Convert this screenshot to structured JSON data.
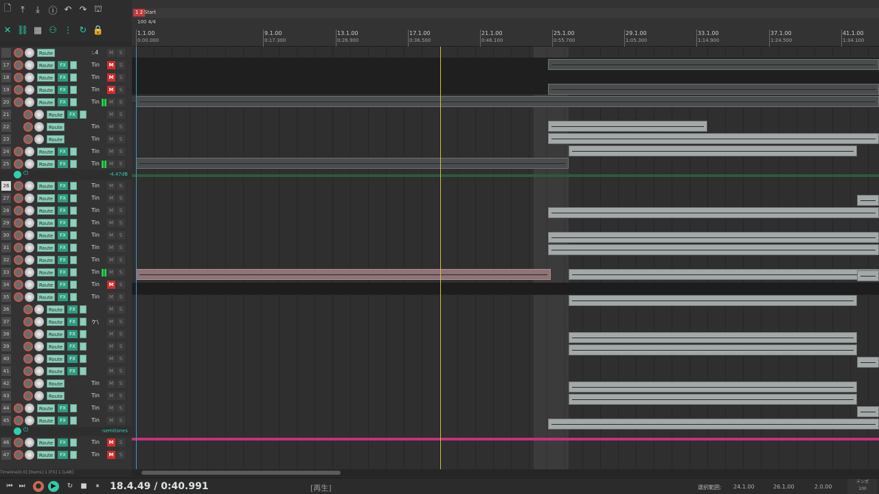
{
  "toolbar": {
    "buttons": [
      "new-file-icon",
      "import-icon",
      "save-icon",
      "info-icon",
      "undo-icon",
      "redo-icon",
      "metronome-icon",
      "ripple-edit-icon",
      "link-icon",
      "grid-icon",
      "snap-icon",
      "snap2-icon",
      "loop-icon",
      "lock-icon"
    ]
  },
  "ruler": {
    "marker_number": "1 2",
    "marker_name": "Start",
    "tempo": "100 4/4",
    "bars": [
      {
        "bar": "1.1.00",
        "time": "0:00.000"
      },
      {
        "bar": "9.1.00",
        "time": "0:17.300"
      },
      {
        "bar": "13.1.00",
        "time": "0:26.900"
      },
      {
        "bar": "17.1.00",
        "time": "0:36.500"
      },
      {
        "bar": "21.1.00",
        "time": "0:46.100"
      },
      {
        "bar": "25.1.00",
        "time": "0:55.700"
      },
      {
        "bar": "29.1.00",
        "time": "1:05.300"
      },
      {
        "bar": "33.1.00",
        "time": "1:14.900"
      },
      {
        "bar": "37.1.00",
        "time": "1:24.500"
      },
      {
        "bar": "41.1.00",
        "time": "1:34.100"
      }
    ]
  },
  "tracks": [
    {
      "num": "",
      "label": ":.4",
      "mute": false
    },
    {
      "num": "17",
      "label": "Tin",
      "mute": true,
      "route_only": false
    },
    {
      "num": "18",
      "label": "Tin",
      "mute": true
    },
    {
      "num": "19",
      "label": "Tin",
      "mute": true
    },
    {
      "num": "20",
      "label": "Tin",
      "mute": false,
      "meter": true
    },
    {
      "num": "21",
      "label": "",
      "mute": false
    },
    {
      "num": "22",
      "label": "Tin",
      "mute": false
    },
    {
      "num": "23",
      "label": "Tin",
      "mute": false
    },
    {
      "num": "24",
      "label": "Tin",
      "mute": false
    },
    {
      "num": "25",
      "label": "Tin",
      "mute": false,
      "meter": true
    }
  ],
  "bus1": {
    "value": "-4.47dB"
  },
  "tracks2": [
    {
      "num": "26",
      "label": "Tin",
      "mute": false
    },
    {
      "num": "27",
      "label": "Tin",
      "mute": false
    },
    {
      "num": "28",
      "label": "Tin",
      "mute": false
    },
    {
      "num": "29",
      "label": "Tin",
      "mute": false
    },
    {
      "num": "30",
      "label": "Tin",
      "mute": false
    },
    {
      "num": "31",
      "label": "Tin",
      "mute": false
    },
    {
      "num": "32",
      "label": "Tin",
      "mute": false
    },
    {
      "num": "33",
      "label": "Tin",
      "mute": false,
      "meter": true
    },
    {
      "num": "34",
      "label": "Tin",
      "mute": true
    },
    {
      "num": "35",
      "label": "Tin",
      "mute": false
    },
    {
      "num": "36",
      "label": "",
      "mute": false
    },
    {
      "num": "37",
      "label": "ケ\\",
      "mute": false
    },
    {
      "num": "38",
      "label": "",
      "mute": false
    },
    {
      "num": "39",
      "label": "",
      "mute": false
    },
    {
      "num": "40",
      "label": "",
      "mute": false
    },
    {
      "num": "41",
      "label": "",
      "mute": false
    },
    {
      "num": "42",
      "label": "Tin",
      "mute": false
    },
    {
      "num": "43",
      "label": "Tin",
      "mute": false
    },
    {
      "num": "44",
      "label": "Tin",
      "mute": false
    },
    {
      "num": "45",
      "label": "Tin",
      "mute": false
    }
  ],
  "bus2": {
    "value": "-semitones"
  },
  "tracks3": [
    {
      "num": "46",
      "label": "Tin",
      "mute": true
    },
    {
      "num": "47",
      "label": "Tin",
      "mute": true
    }
  ],
  "labels": {
    "route": "Route",
    "fx": "FX",
    "m": "M",
    "s": "S"
  },
  "status": "Timeline[0.0] [Items] 1 [FX] 1 [LAB]",
  "transport": {
    "position": "18.4.49 / 0:40.991",
    "state": "[再生]",
    "selection_label": "選択範囲:",
    "sel_start": "24.1.00",
    "sel_end": "26.1.00",
    "sel_len": "2.0.00",
    "tempo_label": "テンポ",
    "tempo_value": "100"
  },
  "colors": {
    "accent": "#2ecfb0",
    "mute_on": "#d22c2c",
    "playhead": "#d8c24a",
    "bus2": "#c8307a"
  }
}
